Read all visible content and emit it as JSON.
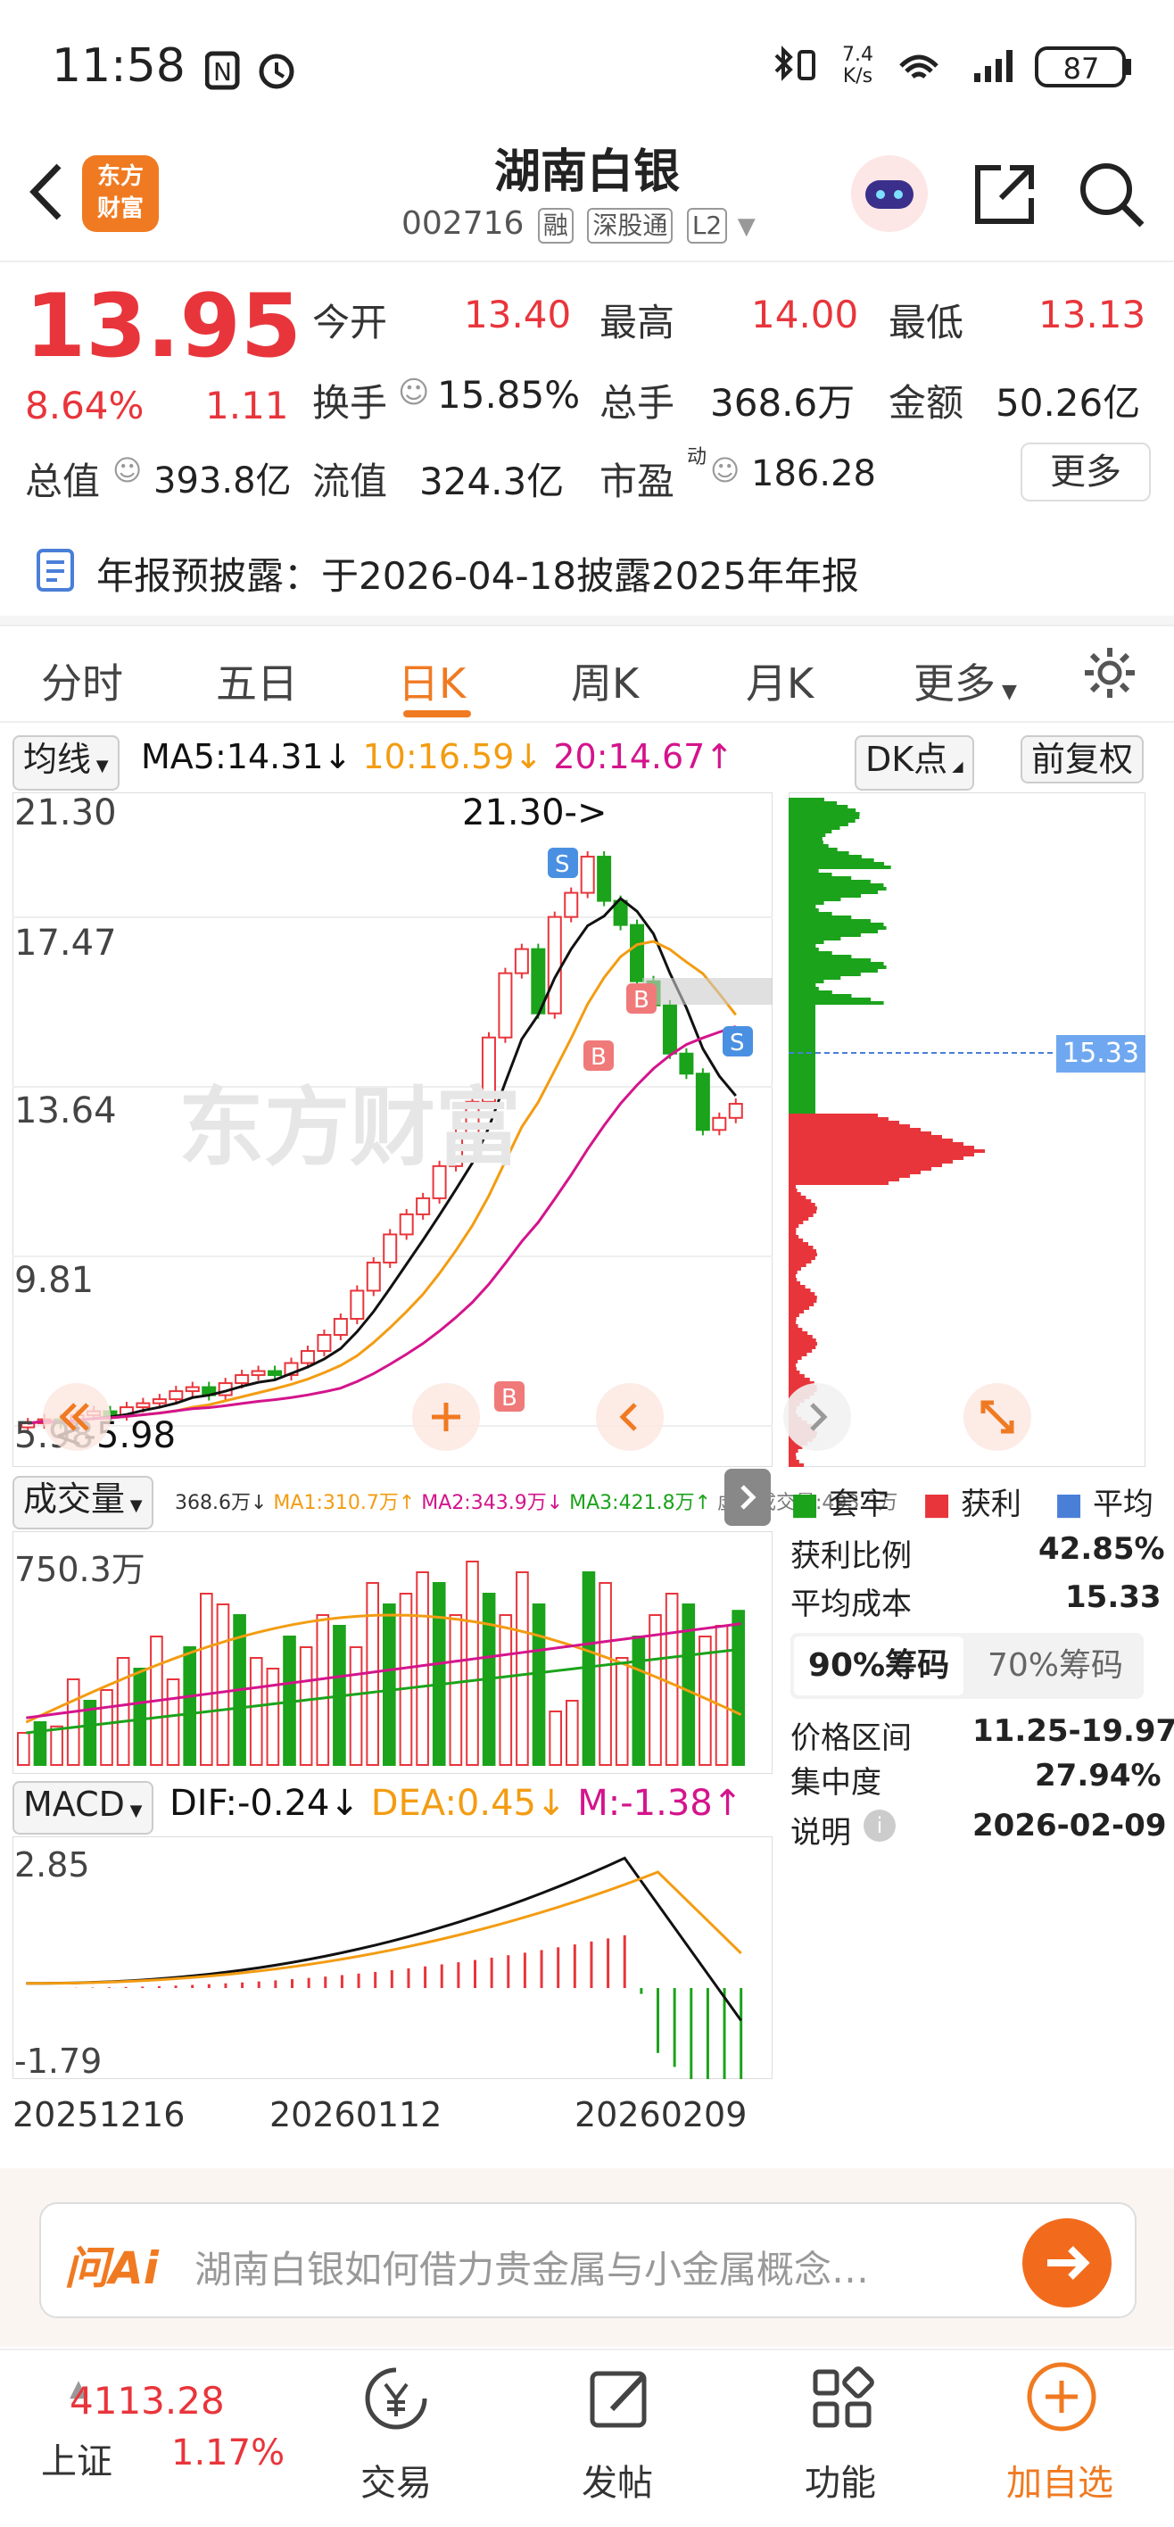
{
  "status_bar": {
    "time": "11:58",
    "net_speed_top": "7.4",
    "net_speed_bottom": "K/s",
    "battery": "87"
  },
  "header": {
    "logo_line1": "东方",
    "logo_line2": "财富",
    "title": "湖南白银",
    "code": "002716",
    "tags": [
      "融",
      "深股通",
      "L2"
    ]
  },
  "quote": {
    "price": "13.95",
    "change_pct": "8.64%",
    "change": "1.11",
    "open_label": "今开",
    "open": "13.40",
    "high_label": "最高",
    "high": "14.00",
    "low_label": "最低",
    "low": "13.13",
    "turnover_label": "换手",
    "turnover": "15.85%",
    "volume_label": "总手",
    "volume": "368.6万",
    "amount_label": "金额",
    "amount": "50.26亿",
    "mktcap_label": "总值",
    "mktcap": "393.8亿",
    "float_label": "流值",
    "float_cap": "324.3亿",
    "pe_label": "市盈",
    "pe_sup": "动",
    "pe": "186.28",
    "more": "更多"
  },
  "notice": {
    "text": "年报预披露：于2026-04-18披露2025年年报"
  },
  "tabs": [
    {
      "label": "分时",
      "active": false
    },
    {
      "label": "五日",
      "active": false
    },
    {
      "label": "日K",
      "active": true
    },
    {
      "label": "周K",
      "active": false
    },
    {
      "label": "月K",
      "active": false
    },
    {
      "label": "更多",
      "active": false
    }
  ],
  "ma_bar": {
    "selector": "均线",
    "ma5": "MA5:14.31↓",
    "ma10": "10:16.59↓",
    "ma20": "20:14.67↑",
    "dk": "DK点",
    "adjust": "前复权"
  },
  "kline": {
    "y_labels": [
      "21.30",
      "17.47",
      "13.64",
      "9.81",
      "5.98"
    ],
    "max_annotation": "21.30->",
    "min_annotation": "<-5.98",
    "watermark": "东方财富",
    "chip_price": "15.33"
  },
  "volume": {
    "selector": "成交量",
    "vol": "368.6万↓",
    "ma1": "MA1:310.7万↑",
    "ma2": "MA2:343.9万↓",
    "ma3": "MA3:421.8万↑",
    "virtual": "虚拟成交量:493.3万",
    "ymax": "750.3万"
  },
  "macd": {
    "selector": "MACD",
    "dif": "DIF:-0.24↓",
    "dea": "DEA:0.45↓",
    "m": "M:-1.38↑",
    "ymax": "2.85",
    "ymin": "-1.79"
  },
  "x_labels": [
    "20251216",
    "20260112",
    "20260209"
  ],
  "chips": {
    "legend": [
      "套牢",
      "获利",
      "平均"
    ],
    "profit_ratio_label": "获利比例",
    "profit_ratio": "42.85%",
    "avg_cost_label": "平均成本",
    "avg_cost": "15.33",
    "tab90": "90%筹码",
    "tab70": "70%筹码",
    "range_label": "价格区间",
    "range": "11.25-19.97",
    "conc_label": "集中度",
    "conc": "27.94%",
    "note_label": "说明",
    "note_date": "2026-02-09"
  },
  "ai_bar": {
    "brand": "问Ai",
    "placeholder": "湖南白银如何借力贵金属与小金属概念…"
  },
  "nav": {
    "index_value": "4113.28",
    "index_name": "上证",
    "index_change": "1.17%",
    "items": [
      "交易",
      "发帖",
      "功能",
      "加自选"
    ]
  },
  "colors": {
    "up": "#e8353b",
    "down": "#1ba31b",
    "accent": "#f07a21",
    "ma5": "#111111",
    "ma10": "#f39c12",
    "ma20": "#d4148c"
  }
}
